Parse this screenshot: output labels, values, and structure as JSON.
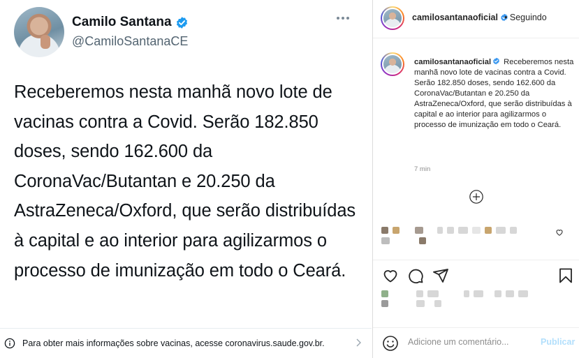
{
  "tweet": {
    "author_name": "Camilo Santana",
    "author_handle": "@CamiloSantanaCE",
    "text": "Receberemos nesta manhã novo lote de vacinas contra a Covid. Serão 182.850 doses, sendo 162.600 da CoronaVac/Butantan e 20.250 da AstraZeneca/Oxford, que serão distribuídas à capital e ao interior para agilizarmos o processo de imunização em todo o Ceará.",
    "info_text": "Para obter mais informações sobre vacinas, acesse coronavirus.saude.gov.br.",
    "icons": {
      "verified": "verified-badge-icon",
      "more": "more-dots-icon",
      "info": "info-icon",
      "chevron": "chevron-right-icon"
    },
    "colors": {
      "verified": "#1d9bf0",
      "handle": "#536471",
      "text": "#0f1419"
    }
  },
  "instagram": {
    "header": {
      "username": "camilosantanaoficial",
      "separator": "•",
      "follow_status": "Seguindo"
    },
    "caption": {
      "username": "camilosantanaoficial",
      "text": "Receberemos nesta manhã novo lote de vacinas contra a Covid. Serão 182.850 doses, sendo 162.600 da CoronaVac/Butantan e 20.250 da AstraZeneca/Oxford, que serão distribuídas à capital e ao interior para agilizarmos o processo de imunização em todo o Ceará.",
      "time": "7 min"
    },
    "composer": {
      "placeholder": "Adicione um comentário...",
      "post_label": "Publicar"
    },
    "icons": {
      "load_more": "plus-circle-icon",
      "like": "heart-icon",
      "comment": "comment-bubble-icon",
      "share": "paper-plane-icon",
      "save": "bookmark-icon",
      "emoji": "emoji-smile-icon",
      "comment_like": "heart-small-icon"
    },
    "colors": {
      "verified": "#3897f0",
      "post_button": "#b2dffc",
      "muted": "#8e8e8e"
    }
  }
}
